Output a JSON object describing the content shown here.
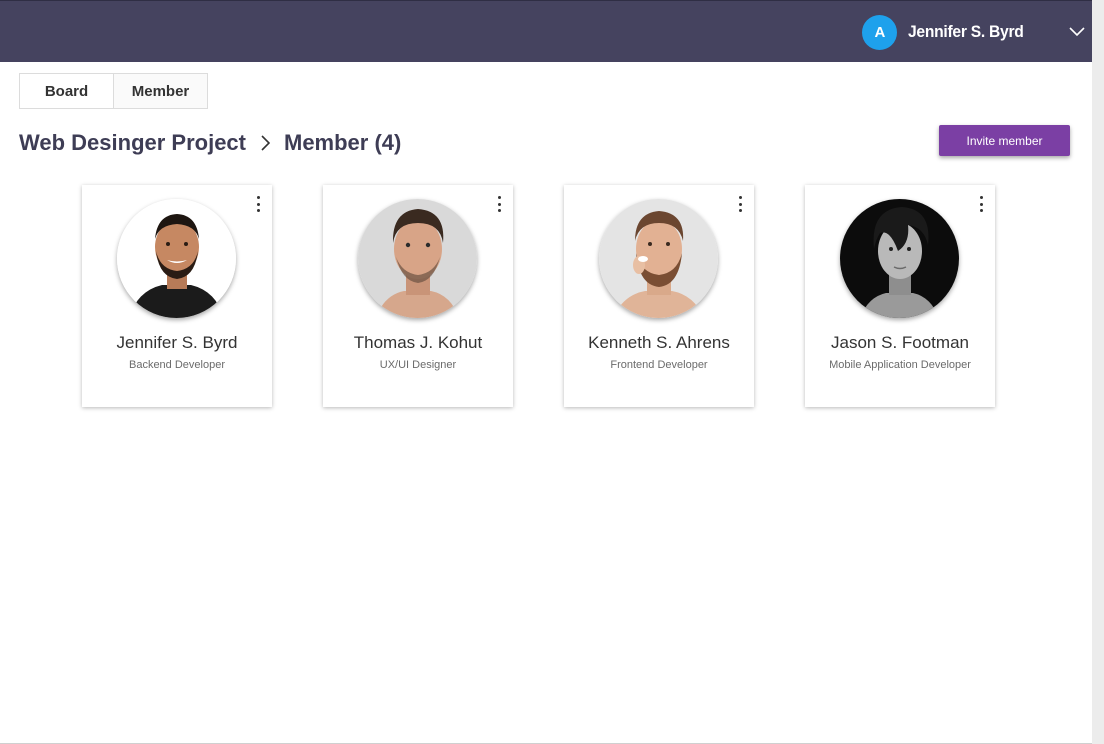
{
  "header": {
    "avatar_initial": "A",
    "user_name": "Jennifer S. Byrd",
    "background_color": "#45435f",
    "avatar_color": "#1ea1ec"
  },
  "tabs": [
    {
      "label": "Board"
    },
    {
      "label": "Member"
    }
  ],
  "breadcrumb": {
    "project": "Web Desinger Project",
    "page": "Member (4)"
  },
  "invite_button": {
    "label": "Invite member",
    "color": "#7b3fa4"
  },
  "members": [
    {
      "name": "Jennifer S. Byrd",
      "role": "Backend Developer",
      "photo": "smiling-man-photo"
    },
    {
      "name": "Thomas J. Kohut",
      "role": "UX/UI Designer",
      "photo": "serious-man-photo"
    },
    {
      "name": "Kenneth S. Ahrens",
      "role": "Frontend Developer",
      "photo": "bearded-man-photo"
    },
    {
      "name": "Jason S. Footman",
      "role": "Mobile Application Developer",
      "photo": "bw-man-photo"
    }
  ]
}
